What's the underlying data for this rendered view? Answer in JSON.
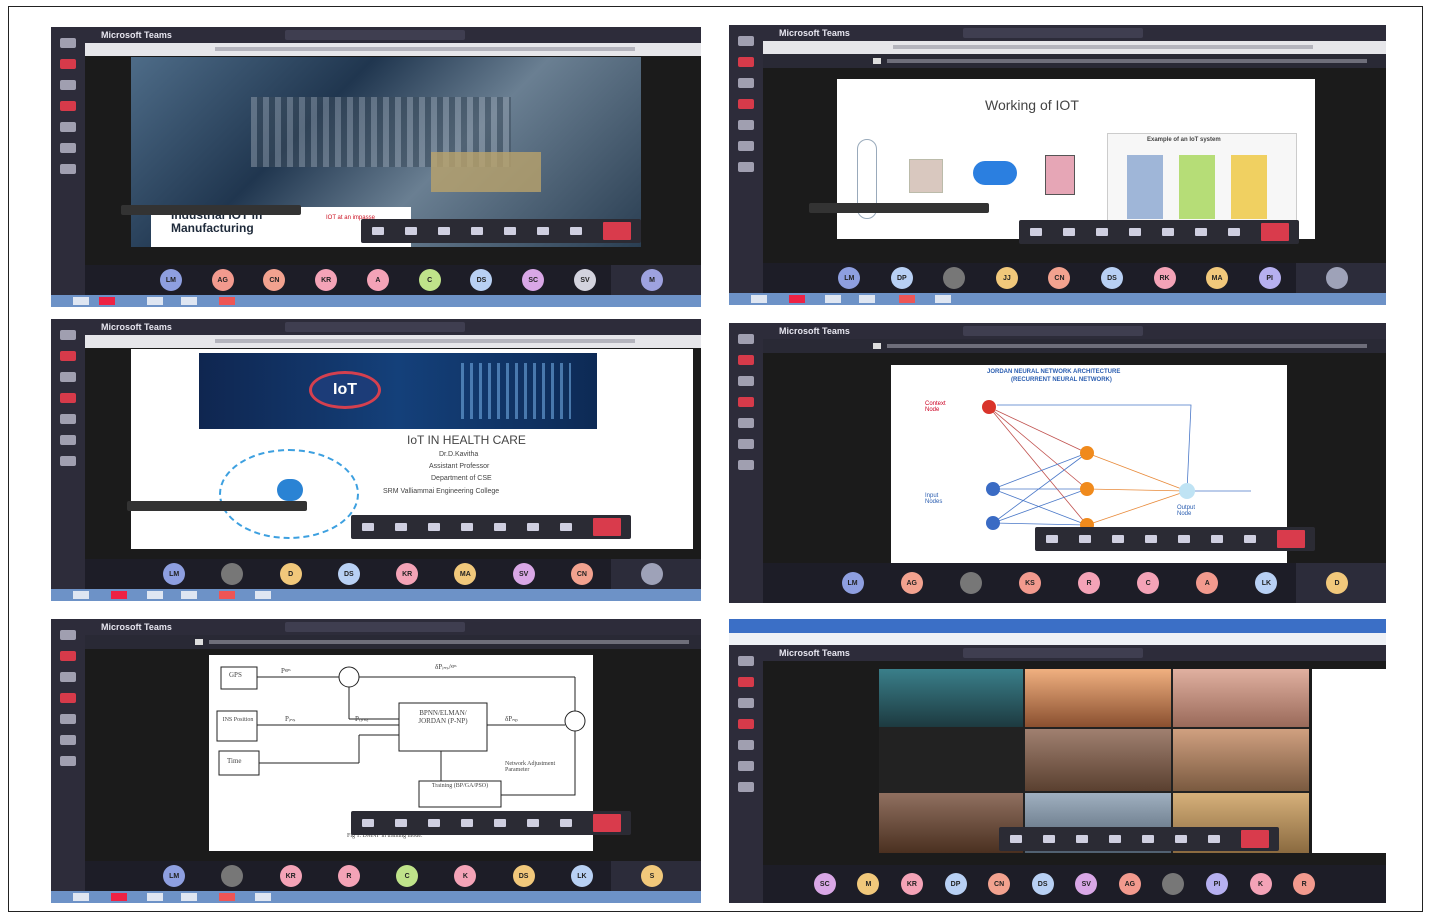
{
  "app_title": "Microsoft Teams",
  "panels": [
    {
      "id": "p1",
      "slide_title_line1": "Industrial IOT in",
      "slide_title_line2": "Manufacturing",
      "slide_tag": "IOT at an impasse",
      "avatars": [
        "LM",
        "AG",
        "CN",
        "KR",
        "A",
        "C",
        "DS",
        "SC",
        "SV"
      ],
      "self_initial": "M"
    },
    {
      "id": "p2",
      "slide_title": "Working of IOT",
      "example_title": "Example of an IoT system",
      "avatars": [
        "LM",
        "DP",
        "",
        "JJ",
        "CN",
        "DS",
        "RK",
        "MA",
        "PI"
      ]
    },
    {
      "id": "p3",
      "iot_logo": "IoT",
      "slide_title": "IoT IN  HEALTH CARE",
      "lines": [
        "Dr.D.Kavitha",
        "Assistant Professor",
        "Department of CSE",
        "SRM Valliammai Engineering College"
      ],
      "avatars": [
        "LM",
        "",
        "D",
        "DS",
        "KR",
        "MA",
        "SV",
        "CN"
      ]
    },
    {
      "id": "p4",
      "slide_title": "JORDAN NEURAL NETWORK ARCHITECTURE",
      "slide_subtitle": "(RECURRENT NEURAL NETWORK)",
      "context_label": "Context Node",
      "input_label": "Input Nodes",
      "output_label": "Output Node",
      "avatars": [
        "LM",
        "AG",
        "",
        "KS",
        "R",
        "C",
        "A",
        "LK"
      ],
      "self_initial": "D"
    },
    {
      "id": "p5",
      "blocks": {
        "gps": "GPS",
        "ins": "INS Position",
        "time": "Time",
        "model": "BPNN/ELMAN/ JORDAN (P-NP)",
        "training": "Training (BP/GA/PSO)",
        "adjust": "Network Adjustment Parameter"
      },
      "labels": {
        "p_gps": "Pᵍᵖˢ",
        "p_ins": "Pᵢₙₛ",
        "p_time": "Pₜᵢₘₑ",
        "dp_top": "δPᵢₙₛ/ᵍᵖˢ",
        "dp_mid": "δPₙₚ"
      },
      "caption": "Fig 1. DMNF in training mode.",
      "avatars": [
        "LM",
        "",
        "KR",
        "R",
        "C",
        "K",
        "DS",
        "LK"
      ],
      "self_initial": "S"
    },
    {
      "id": "p6",
      "avatars": [
        "SC",
        "M",
        "KR",
        "DP",
        "CN",
        "DS",
        "SV",
        "AG",
        "",
        "PI",
        "K",
        "R"
      ]
    }
  ]
}
